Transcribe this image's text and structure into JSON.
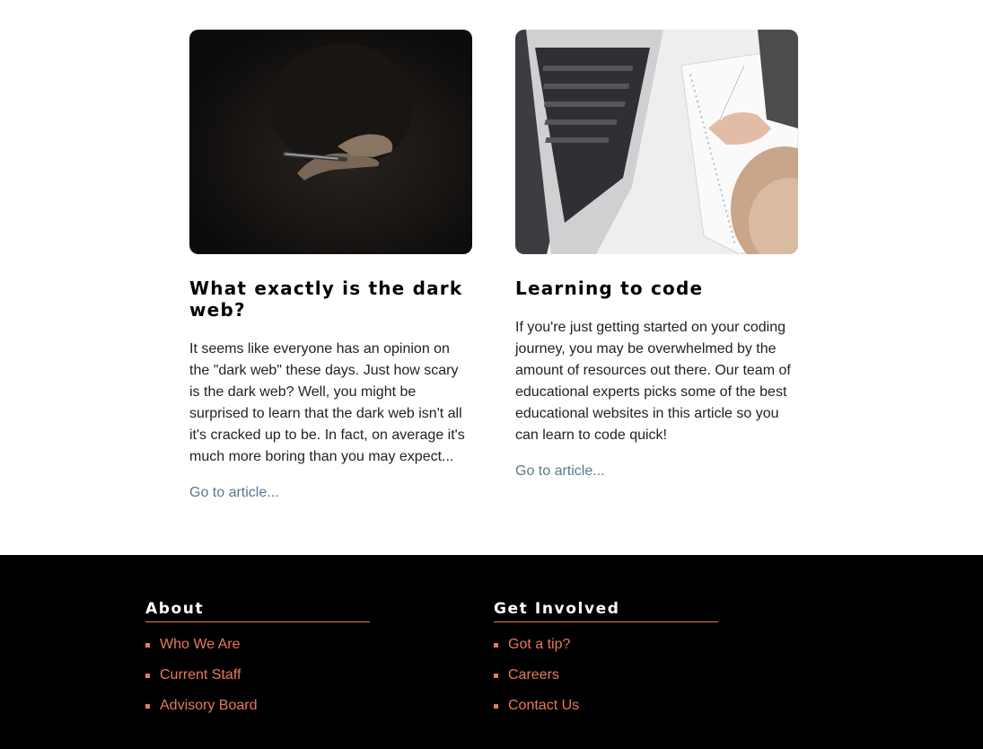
{
  "articles": [
    {
      "image_icon": "phone-in-dark-photo",
      "title": "What exactly is the dark web?",
      "body": "It seems like everyone has an opinion on the \"dark web\" these days. Just how scary is the dark web? Well, you might be surprised to learn that the dark web isn't all it's cracked up to be. In fact, on average it's much more boring than you may expect...",
      "link": "Go to article..."
    },
    {
      "image_icon": "laptop-and-notebook-photo",
      "title": "Learning to code",
      "body": "If you're just getting started on your coding journey, you may be overwhelmed by the amount of resources out there. Our team of educational experts picks some of the best educational websites in this article so you can learn to code quick!",
      "link": "Go to article..."
    }
  ],
  "footer": {
    "about": {
      "title": "About",
      "items": [
        "Who We Are",
        "Current Staff",
        "Advisory Board"
      ]
    },
    "involved": {
      "title": "Get Involved",
      "items": [
        "Got a tip?",
        "Careers",
        "Contact Us"
      ]
    }
  },
  "colors": {
    "accent": "#e8795a",
    "link": "#5a7a8a",
    "footer_bg": "#000000"
  }
}
